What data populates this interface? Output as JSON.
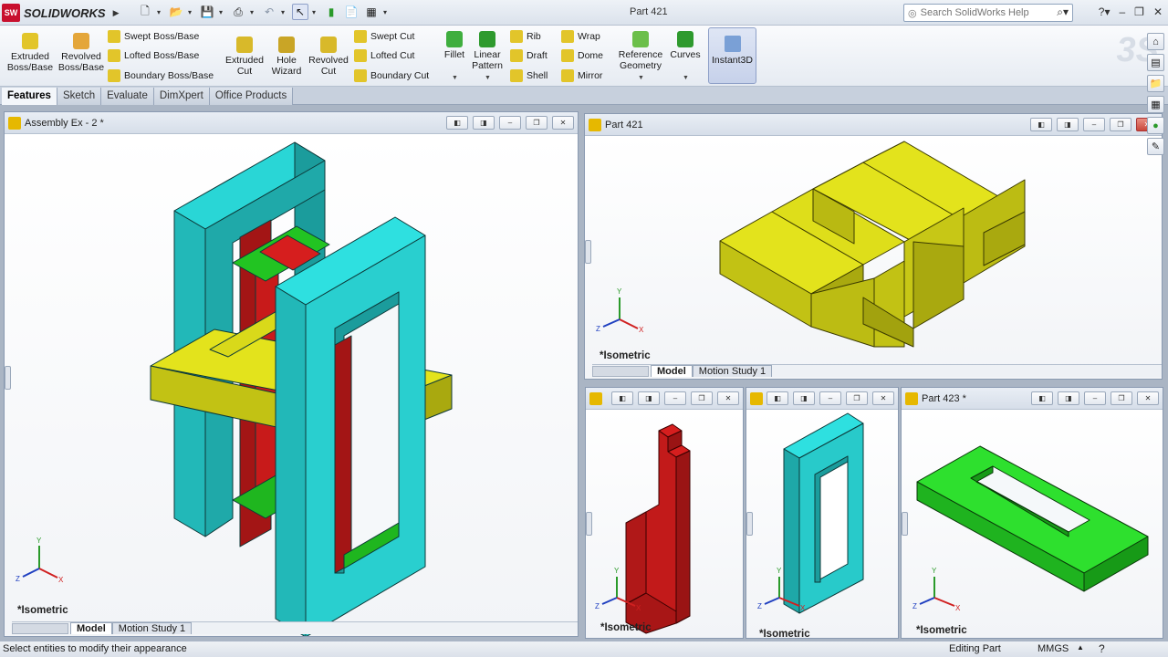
{
  "app": {
    "name": "SOLIDWORKS",
    "doc_title": "Part 421"
  },
  "search": {
    "placeholder": "Search SolidWorks Help"
  },
  "ribbon": {
    "extruded_boss": "Extruded Boss/Base",
    "revolved_boss": "Revolved Boss/Base",
    "swept_boss": "Swept Boss/Base",
    "lofted_boss": "Lofted Boss/Base",
    "boundary_boss": "Boundary Boss/Base",
    "extruded_cut": "Extruded Cut",
    "hole_wizard": "Hole Wizard",
    "revolved_cut": "Revolved Cut",
    "swept_cut": "Swept Cut",
    "lofted_cut": "Lofted Cut",
    "boundary_cut": "Boundary Cut",
    "fillet": "Fillet",
    "linear_pattern": "Linear Pattern",
    "rib": "Rib",
    "draft": "Draft",
    "shell": "Shell",
    "wrap": "Wrap",
    "dome": "Dome",
    "mirror": "Mirror",
    "reference_geometry": "Reference Geometry",
    "curves": "Curves",
    "instant3d": "Instant3D"
  },
  "tabs": [
    "Features",
    "Sketch",
    "Evaluate",
    "DimXpert",
    "Office Products"
  ],
  "panes": {
    "assembly": {
      "title": "Assembly Ex - 2 *",
      "view": "*Isometric",
      "tab_model": "Model",
      "tab_motion": "Motion Study 1"
    },
    "part421": {
      "title": "Part 421",
      "view": "*Isometric",
      "tab_model": "Model",
      "tab_motion": "Motion Study 1"
    },
    "part_red": {
      "view": "*Isometric"
    },
    "part_cyan": {
      "view": "*Isometric"
    },
    "part423": {
      "title": "Part 423 *",
      "view": "*Isometric"
    }
  },
  "axis_labels": {
    "x": "X",
    "y": "Y",
    "z": "Z"
  },
  "status": {
    "message": "Select entities to modify their appearance",
    "mode": "Editing Part",
    "units": "MMGS"
  },
  "colors": {
    "cyan": "#24c9c9",
    "yellow": "#d9d91a",
    "red": "#cc1b1b",
    "green": "#1ec21e"
  }
}
